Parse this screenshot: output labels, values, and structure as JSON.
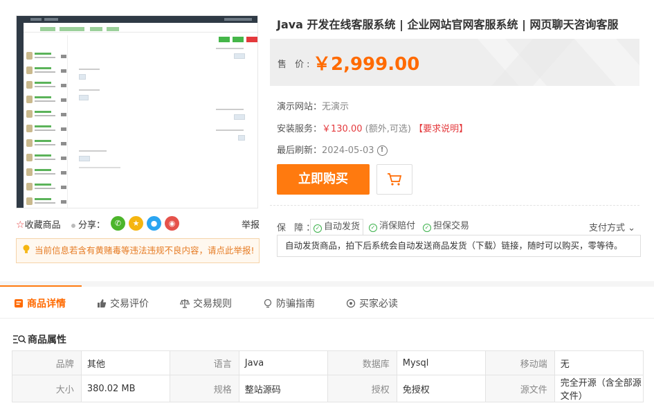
{
  "title": "Java 开发在线客服系统 | 企业网站官网客服系统 | 网页聊天咨询客服",
  "price": {
    "label": "售 价:",
    "value": "￥2,999.00"
  },
  "demo": {
    "label": "演示网站：",
    "value": "无演示"
  },
  "install": {
    "label": "安装服务：",
    "price": "￥130.00",
    "note": "(额外,可选)",
    "link": "【要求说明】"
  },
  "refresh": {
    "label": "最后刷新：",
    "date": "2024-05-03",
    "icon": "clock-icon"
  },
  "buttons": {
    "buy": "立即购买",
    "cart_icon": "cart-icon"
  },
  "guarantee": {
    "label": "保 障：",
    "items": [
      "自动发货",
      "消保赔付",
      "担保交易"
    ],
    "paytype": "支付方式",
    "description": "自动发货商品，拍下后系统会自动发送商品发货（下载）链接，随时可以购买，零等待。"
  },
  "actions": {
    "favorite": "收藏商品",
    "share": "分享：",
    "report": "举报"
  },
  "share_icons": [
    {
      "name": "wechat-icon",
      "color": "#4cb52b"
    },
    {
      "name": "qzone-icon",
      "color": "#f5b510"
    },
    {
      "name": "qq-icon",
      "color": "#2aa5f1"
    },
    {
      "name": "weibo-icon",
      "color": "#e5524b"
    }
  ],
  "notice": "当前信息若含有黄赌毒等违法违规不良内容，请点此举报!",
  "tabs": [
    "商品详情",
    "交易评价",
    "交易规则",
    "防骗指南",
    "买家必读"
  ],
  "attributes": {
    "title": "商品属性",
    "rows": [
      [
        [
          "品牌",
          "其他"
        ],
        [
          "语言",
          "Java"
        ],
        [
          "数据库",
          "Mysql"
        ],
        [
          "移动端",
          "无"
        ]
      ],
      [
        [
          "大小",
          "380.02 MB"
        ],
        [
          "规格",
          "整站源码"
        ],
        [
          "授权",
          "免授权"
        ],
        [
          "源文件",
          "完全开源（含全部源文件）"
        ]
      ]
    ]
  },
  "colors": {
    "accent": "#ff6a00",
    "button": "#ff7a0f",
    "danger": "#e4393c",
    "ok": "#3bb14a"
  }
}
